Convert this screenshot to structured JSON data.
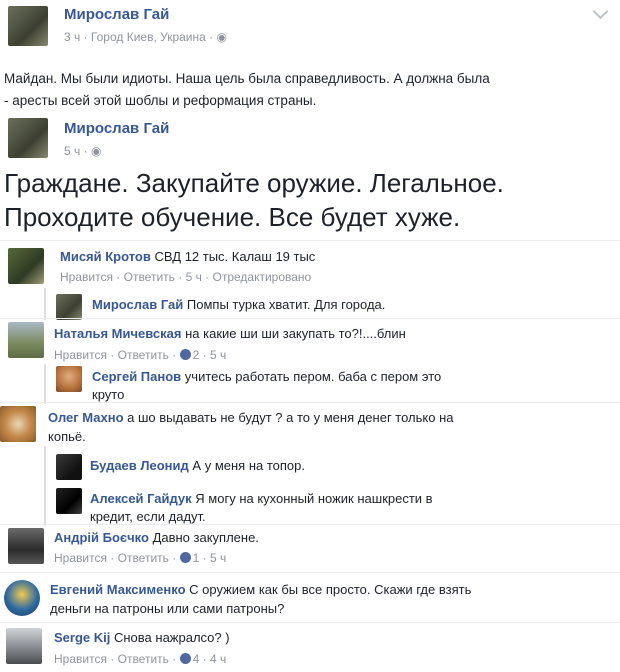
{
  "post1": {
    "author": "Мирослав Гай",
    "meta": "3 ч · Город Киев, Украина ·",
    "text_line1": "Майдан. Мы были идиоты. Наша цель была справедливость. А должна была",
    "text_line2": "- аресты всей этой шоблы и реформация страны."
  },
  "post2": {
    "author": "Мирослав Гай",
    "meta": "5 ч ·",
    "text_line1": "Граждане. Закупайте оружие. Легальное.",
    "text_line2": "Проходите обучение. Все будет хуже."
  },
  "comments": {
    "c1": {
      "author": "Мисяй Кротов",
      "text": "СВД 12 тыс. Калаш 19 тыс",
      "actions": "Нравится · Ответить · 5 ч · Отредактировано"
    },
    "r1": {
      "author": "Мирослав Гай",
      "text": "Помпы турка хватит. Для города."
    },
    "c2": {
      "author": "Наталья Мичевская",
      "text": "на какие ши ши закупать то?!....блин",
      "actions_left": "Нравится · Ответить ·",
      "likes": "2",
      "time": "· 5 ч"
    },
    "r2": {
      "author": "Сергей Панов",
      "text_line1": "учитесь работать пером. баба с пером это",
      "text_line2": "круто"
    },
    "c3": {
      "author": "Олег Махно",
      "text_line1": "а шо выдавать не будут ? а то у меня денег только на",
      "text_line2": "копьё."
    },
    "r3": {
      "author": "Будаев Леонид",
      "text": "А у меня на топор."
    },
    "r4": {
      "author": "Алексей Гайдук",
      "text_line1": "Я могу на кухонный ножик нашкрести в",
      "text_line2": "кредит, если дадут."
    },
    "c4": {
      "author": "Андрій Боєчко",
      "text": "Давно закуплене.",
      "actions_left": "Нравится · Ответить ·",
      "likes": "1",
      "time": "· 5 ч"
    },
    "c5": {
      "author": "Евгений Максименко",
      "text_line1": "С оружием как бы все просто. Скажи где взять",
      "text_line2": "деньги на патроны или сами патроны?"
    },
    "c6": {
      "author": "Serge Kij",
      "text": "Снова нажралсо? )",
      "actions_left": "Нравится · Ответить ·",
      "likes": "4",
      "time": "· 4 ч"
    }
  },
  "colors": {
    "name": "#365899",
    "meta": "#90949c",
    "like_badge": "#4e69a2"
  }
}
